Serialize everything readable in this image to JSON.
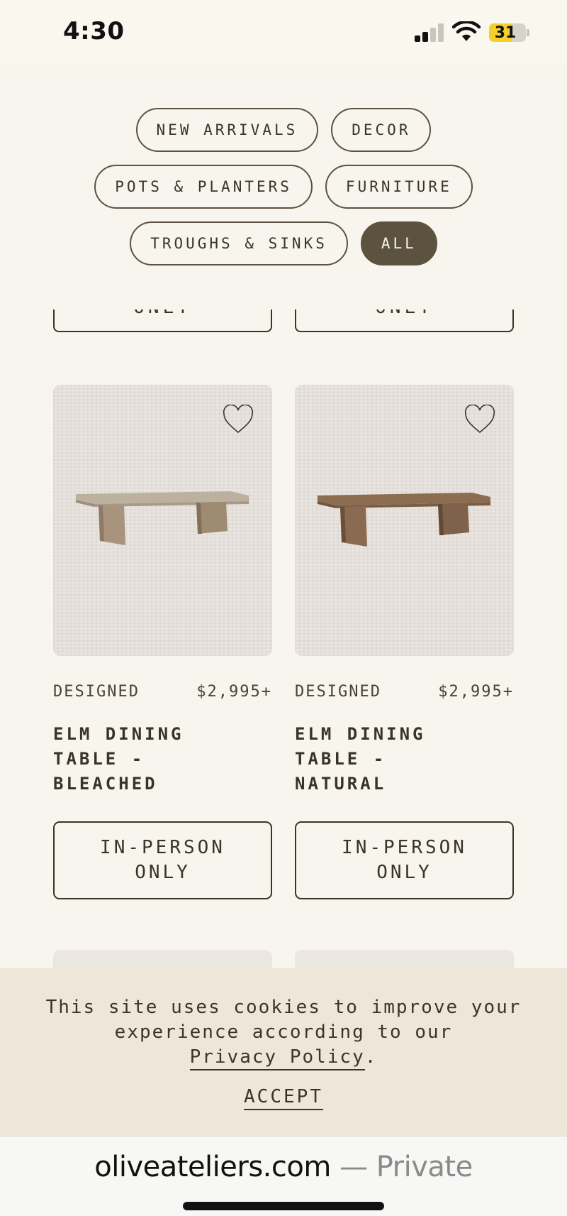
{
  "status_bar": {
    "time": "4:30",
    "battery": "31",
    "battery_level": 0.31
  },
  "filters": {
    "rows": [
      [
        {
          "label": "NEW ARRIVALS",
          "active": false
        },
        {
          "label": "DECOR",
          "active": false
        }
      ],
      [
        {
          "label": "POTS & PLANTERS",
          "active": false
        },
        {
          "label": "FURNITURE",
          "active": false
        }
      ],
      [
        {
          "label": "TROUGHS & SINKS",
          "active": false
        },
        {
          "label": "ALL",
          "active": true
        }
      ]
    ]
  },
  "products": [
    {
      "category": "DESIGNED",
      "price": "$2,995+",
      "title_lines": [
        "ELM DINING",
        "TABLE -",
        "BLEACHED"
      ],
      "button_lines": [
        "IN-PERSON",
        "ONLY"
      ],
      "wood_color": "#b8ab9a"
    },
    {
      "category": "DESIGNED",
      "price": "$2,995+",
      "title_lines": [
        "ELM DINING",
        "TABLE -",
        "NATURAL"
      ],
      "button_lines": [
        "IN-PERSON",
        "ONLY"
      ],
      "wood_color": "#8a6c52"
    }
  ],
  "partial_buttons": [
    "ONLY",
    "ONLY"
  ],
  "cookie": {
    "line1": "This site uses cookies to improve your",
    "line2": "experience according to our",
    "link": "Privacy Policy",
    "after_link": ".",
    "accept": "ACCEPT"
  },
  "browser": {
    "domain": "oliveateliers.com",
    "suffix": " — Private"
  },
  "colors": {
    "background": "#f8f5ee",
    "active_chip": "#5c5240",
    "text": "#3b3429",
    "cookie_bg": "#eee7d9"
  }
}
